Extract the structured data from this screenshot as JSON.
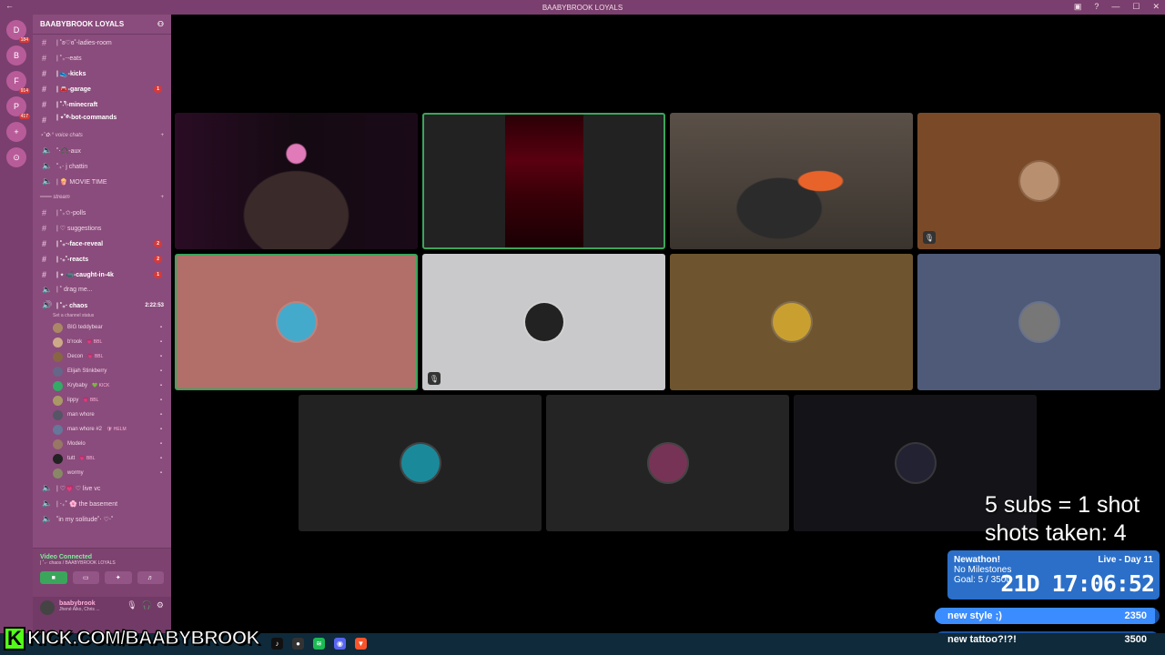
{
  "window": {
    "title": "BAABYBROOK LOYALS"
  },
  "servers": [
    {
      "label": "D",
      "badge": "184"
    },
    {
      "label": "B",
      "badge": ""
    },
    {
      "label": "F",
      "badge": "914"
    },
    {
      "label": "P",
      "badge": "417"
    },
    {
      "label": "+",
      "badge": ""
    },
    {
      "label": "⊙",
      "badge": ""
    }
  ],
  "sidebar": {
    "server_name": "BAABYBROOK LOYALS",
    "channels_top": [
      {
        "name": "| ˚ʚ♡ɞ˚-ladies-room",
        "badge": "",
        "bold": false
      },
      {
        "name": "| ˚₊‧-eats",
        "badge": "",
        "bold": false
      },
      {
        "name": "| 👟-kicks",
        "badge": "",
        "bold": true
      },
      {
        "name": "| 🚘-garage",
        "badge": "1",
        "bold": true
      },
      {
        "name": "| ˚˖𓍢ִ໋-minecraft",
        "badge": "",
        "bold": true
      },
      {
        "name": "| ⋆˚࿔-bot-commands",
        "badge": "",
        "bold": true
      }
    ],
    "category_voice": "⋆˚✿˖° voice chats",
    "voice_top": [
      {
        "name": "˚‧🎧-aux"
      },
      {
        "name": "˚₊‧ j chattin"
      },
      {
        "name": "| 🍿 MOVIE TIME"
      }
    ],
    "category_stream": "═══ stream",
    "channels_stream": [
      {
        "name": "| ˚₊✩-polls",
        "badge": "",
        "bold": false
      },
      {
        "name": "| ♡ suggestions",
        "badge": "",
        "bold": false
      },
      {
        "name": "| ˚₊‧-face-reveal",
        "badge": "2",
        "bold": true
      },
      {
        "name": "| ‧₊˚-reacts",
        "badge": "2",
        "bold": true
      },
      {
        "name": "| ⋆ 📹-caught-in-4k",
        "badge": "1",
        "bold": true
      }
    ],
    "voice_mid": [
      {
        "name": "| ˚ drag me..."
      }
    ],
    "active_voice": {
      "name": "| ˚₊‧ chaos",
      "time": "2:22:53",
      "status": "Set a channel status"
    },
    "voice_users": [
      {
        "name": "BIG teddybear",
        "tag": "",
        "color": "#a86"
      },
      {
        "name": "b'rook",
        "tag": "💗 BBL",
        "color": "#ca8"
      },
      {
        "name": "Decon",
        "tag": "💗 BBL",
        "color": "#864"
      },
      {
        "name": "Elijah Stinkberry",
        "tag": "",
        "color": "#668"
      },
      {
        "name": "Krybaby",
        "tag": "💚 KICK",
        "color": "#3a6"
      },
      {
        "name": "lippy",
        "tag": "💗 BBL",
        "color": "#a96"
      },
      {
        "name": "man whore",
        "tag": "",
        "color": "#556"
      },
      {
        "name": "man whore #2",
        "tag": "🛡 HELM",
        "color": "#679"
      },
      {
        "name": "Modelo",
        "tag": "",
        "color": "#976"
      },
      {
        "name": "tutt",
        "tag": "💗 BBL",
        "color": "#222"
      },
      {
        "name": "wormy",
        "tag": "",
        "color": "#886"
      }
    ],
    "voice_bottom": [
      {
        "name": "| ♡💗 ♡ live vc"
      },
      {
        "name": "| ‧₊˚ 🌸 the basement"
      },
      {
        "name": "˚in my solitude˚‧ ♡‧˚"
      }
    ],
    "voice_panel": {
      "title": "Video Connected",
      "sub": "| ˚₊‧ chaos / BAABYBROOK LOYALS"
    },
    "user": {
      "name": "baabybrook",
      "sub": "Jhené Aiko, Chris ..."
    }
  },
  "tiles": [
    {
      "kind": "cam",
      "bg": "#1a0a18",
      "speaking": false,
      "muted": false
    },
    {
      "kind": "screen",
      "bg": "#222",
      "speaking": true,
      "muted": false
    },
    {
      "kind": "cam",
      "bg": "#3a342e",
      "speaking": false,
      "muted": false
    },
    {
      "kind": "avatar",
      "bg": "#7a4a28",
      "speaking": false,
      "muted": true,
      "avatar_color": "#b89070"
    },
    {
      "kind": "avatar",
      "bg": "#b26e68",
      "speaking": true,
      "muted": false,
      "avatar_color": "#4ac"
    },
    {
      "kind": "avatar",
      "bg": "#c9c9cb",
      "speaking": false,
      "muted": true,
      "avatar_color": "#222"
    },
    {
      "kind": "avatar",
      "bg": "#6e5530",
      "speaking": false,
      "muted": false,
      "avatar_color": "#c9a030"
    },
    {
      "kind": "avatar",
      "bg": "#4e5a78",
      "speaking": false,
      "muted": false,
      "avatar_color": "#777"
    },
    {
      "kind": "avatar",
      "bg": "#222",
      "speaking": false,
      "muted": false,
      "avatar_color": "#1a8a9a"
    },
    {
      "kind": "avatar",
      "bg": "#242424",
      "speaking": false,
      "muted": false,
      "avatar_color": "#735"
    },
    {
      "kind": "avatar",
      "bg": "#141418",
      "speaking": false,
      "muted": false,
      "avatar_color": "#223"
    }
  ],
  "overlay": {
    "line1": "5 subs = 1 shot",
    "line2": "shots taken: 4",
    "newathon_title": "Newathon!",
    "live_day": "Live - Day 11",
    "milestones": "No Milestones",
    "goal": "Goal: 5 / 3500",
    "timer": "21D 17:06:52",
    "goals": [
      {
        "label": "new style ;)",
        "value": "2350",
        "progress": 0.98
      },
      {
        "label": "new tattoo?!?!",
        "value": "3500",
        "progress": 0.0
      }
    ]
  },
  "kick": {
    "letter": "K",
    "url": "KICK.COM/BAABYBROOK"
  },
  "taskbar_icons": [
    {
      "icon": "tiktok-icon",
      "glyph": "♪",
      "color": "#111"
    },
    {
      "icon": "obs-icon",
      "glyph": "●",
      "color": "#333"
    },
    {
      "icon": "spotify-icon",
      "glyph": "≋",
      "color": "#1db954"
    },
    {
      "icon": "discord-icon",
      "glyph": "◉",
      "color": "#5865f2"
    },
    {
      "icon": "brave-icon",
      "glyph": "▼",
      "color": "#fb542b"
    }
  ]
}
